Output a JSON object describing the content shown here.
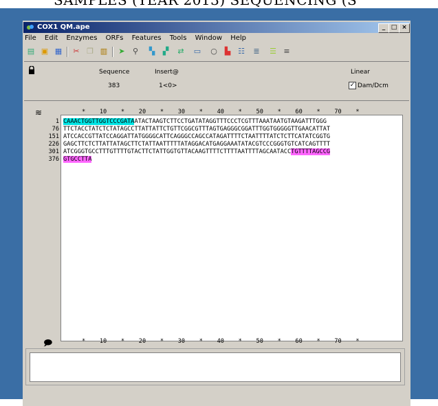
{
  "background_text": "SAMPLES (YEAR 2013) SEQUENCING (S",
  "window": {
    "title": "COX1 QM.ape",
    "min": "_",
    "max": "□",
    "close": "×"
  },
  "menu": [
    "File",
    "Edit",
    "Enzymes",
    "ORFs",
    "Features",
    "Tools",
    "Window",
    "Help"
  ],
  "toolbar_icons": [
    "new-doc-icon",
    "open-icon",
    "save-icon",
    "cut-icon",
    "copy-icon",
    "paste-icon",
    "cursor-icon",
    "find-icon",
    "enzyme-icon",
    "features-icon",
    "orf-icon",
    "table-icon",
    "circle-map-icon",
    "graph-icon",
    "align-icon",
    "translate-icon",
    "color-icon",
    "list-icon"
  ],
  "info": {
    "sequence_label": "Sequence",
    "sequence_value": "383",
    "insert_label": "Insert@",
    "insert_value": "1<0>",
    "linear_label": "Linear",
    "dam_label": "Dam/Dcm",
    "dam_checked": true
  },
  "ruler": "*    10    *    20    *    30    *    40    *    50    *    60    *    70    *",
  "sequence_rows": [
    {
      "num": "1",
      "pre": "",
      "cyan": "CAAACTGGTTGGTCCCGATA",
      "text": "ATACTAAGTCTTCCTGATATAGGTTTCCCTCGTTTAAATAATGTAAGATTTGGG",
      "mag": ""
    },
    {
      "num": "76",
      "pre": "",
      "cyan": "",
      "text": "TTCTACCTATCTCTATAGCCTTATTATTCTGTTCGGCGTTTAGTGAGGGCGGATTTGGTGGGGGTTGAACATTAT",
      "mag": ""
    },
    {
      "num": "151",
      "pre": "",
      "cyan": "",
      "text": "ATCCACCGTTATCCAGGATTATGGGGCATTCAGGGCCAGCCATAGATTTTCTAATTTTATCTCTTCATATCGGTG",
      "mag": ""
    },
    {
      "num": "226",
      "pre": "",
      "cyan": "",
      "text": "GAGCTTCTCTTATTATAGCTTCTATTAATTTTTATAGGACATGAGGAAATATACGTCCCGGGTGTCATCAGTTTT",
      "mag": ""
    },
    {
      "num": "301",
      "pre": "",
      "cyan": "",
      "text": "ATCGGGTGCCTTTGTTTTGTACTTCTATTGGTGTTACAAGTTTTCTTTTAATTTTAGCAATACC",
      "mag": "TGTTTTAGCCG"
    },
    {
      "num": "376",
      "pre": "",
      "cyan": "",
      "text": "",
      "mag": "GTGCCTTA"
    }
  ]
}
